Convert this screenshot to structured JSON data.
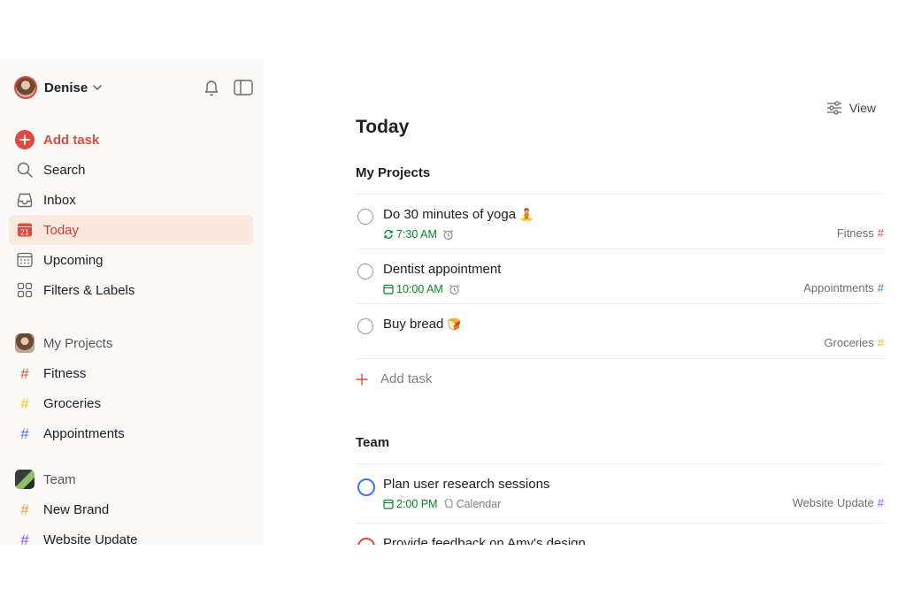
{
  "user": {
    "name": "Denise"
  },
  "nav": {
    "add_task": "Add task",
    "search": "Search",
    "inbox": "Inbox",
    "today": "Today",
    "today_date": "21",
    "upcoming": "Upcoming",
    "filters": "Filters & Labels"
  },
  "sidebar_projects": {
    "header": "My Projects",
    "items": [
      {
        "label": "Fitness",
        "color": "#dc4c3e"
      },
      {
        "label": "Groceries",
        "color": "#fad000"
      },
      {
        "label": "Appointments",
        "color": "#4073ff"
      }
    ]
  },
  "sidebar_team": {
    "header": "Team",
    "items": [
      {
        "label": "New Brand",
        "color": "#ff9933"
      },
      {
        "label": "Website Update",
        "color": "#884dff"
      }
    ]
  },
  "main": {
    "view_label": "View",
    "title": "Today",
    "section_my_projects": "My Projects",
    "section_team": "Team",
    "add_task": "Add task",
    "tasks": [
      {
        "title": "Do 30 minutes of yoga",
        "emoji": "🧘",
        "time": "7:30 AM",
        "project": "Fitness"
      },
      {
        "title": "Dentist appointment",
        "time": "10:00 AM",
        "project": "Appointments"
      },
      {
        "title": "Buy bread",
        "emoji": "🍞",
        "project": "Groceries"
      }
    ],
    "team_tasks": [
      {
        "title": "Plan user research sessions",
        "time": "2:00 PM",
        "label": "Calendar",
        "project": "Website Update"
      },
      {
        "title": "Provide feedback on Amy's design"
      }
    ]
  },
  "colors": {
    "accent": "#dc4c3e",
    "today_bg": "#fbe8df",
    "time_green": "#058527",
    "team_blue": "#4073ff"
  }
}
